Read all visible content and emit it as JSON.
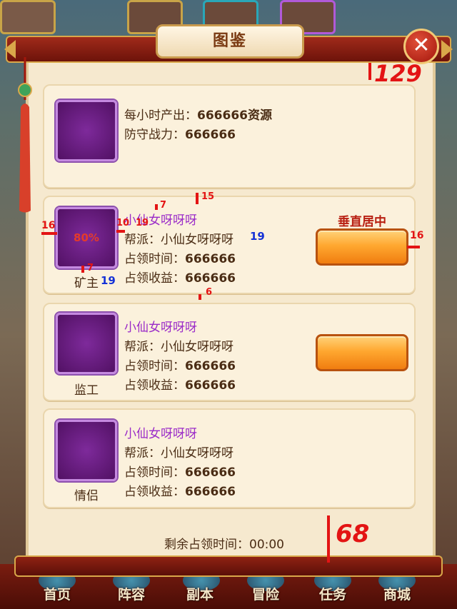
{
  "window": {
    "title": "图鉴",
    "close_symbol": "✕"
  },
  "summary_card": {
    "line1_label": "每小时产出：",
    "line1_value": "666666资源",
    "line2_label": "防守战力：",
    "line2_value": "666666"
  },
  "entries": [
    {
      "role": "矿主",
      "avatar_text": "80%",
      "name": "小仙女呀呀呀",
      "guild_label": "帮派：",
      "guild_value": "小仙女呀呀呀",
      "time_label": "占领时间：",
      "time_value": "666666",
      "income_label": "占领收益：",
      "income_value": "666666",
      "button_caption": "垂直居中"
    },
    {
      "role": "监工",
      "name": "小仙女呀呀呀",
      "guild_label": "帮派：",
      "guild_value": "小仙女呀呀呀",
      "time_label": "占领时间：",
      "time_value": "666666",
      "income_label": "占领收益：",
      "income_value": "666666"
    },
    {
      "role": "情侣",
      "name": "小仙女呀呀呀",
      "guild_label": "帮派：",
      "guild_value": "小仙女呀呀呀",
      "time_label": "占领时间：",
      "time_value": "666666",
      "income_label": "占领收益：",
      "income_value": "666666"
    }
  ],
  "footer": {
    "remaining_label": "剩余占领时间：00:00"
  },
  "bottom_nav": [
    "首页",
    "阵容",
    "副本",
    "冒险",
    "任务",
    "商城"
  ],
  "annotations": {
    "top_gap": "129",
    "footer_gap": "68",
    "a16_left": "16",
    "a16_right": "16",
    "a7_top": "7",
    "a15": "15",
    "a10": "10",
    "a19_red": "19",
    "a19_blue_guild": "19",
    "a7_role": "7",
    "a19_blue_role": "19",
    "a6": "6"
  },
  "colors": {
    "name": "#9a2ac8",
    "text": "#4a2c14",
    "annotation_red": "#e31414",
    "annotation_blue": "#1431d6"
  }
}
